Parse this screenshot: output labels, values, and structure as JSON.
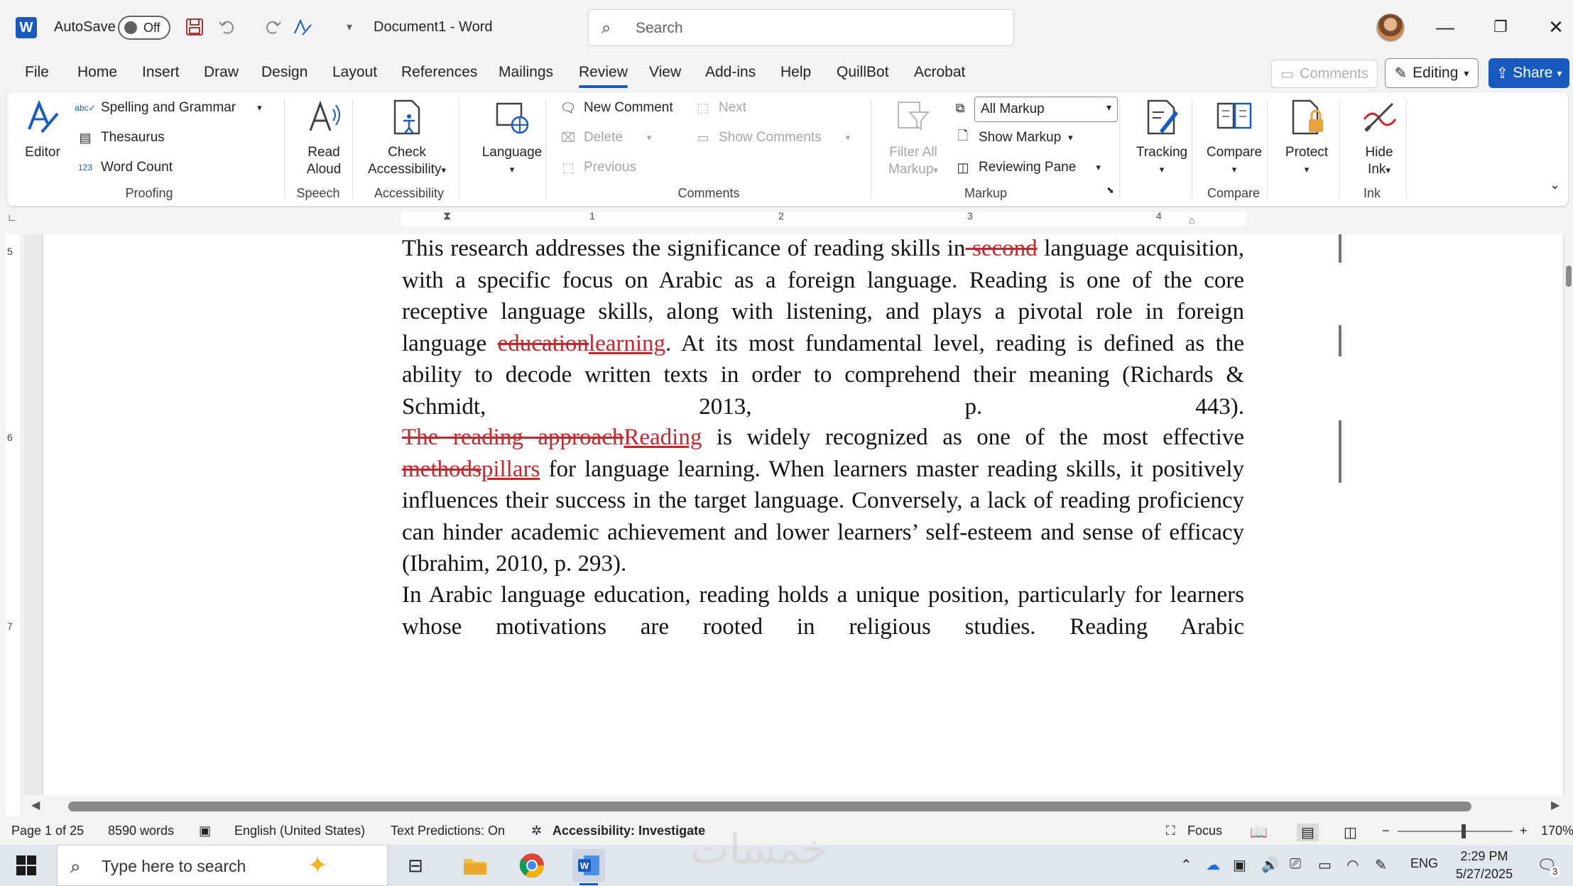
{
  "titlebar": {
    "app_logo": "W",
    "autosave_label": "AutoSave",
    "autosave_state": "Off",
    "document_title": "Document1  -  Word",
    "search_placeholder": "Search"
  },
  "menu": {
    "tabs": [
      "File",
      "Home",
      "Insert",
      "Draw",
      "Design",
      "Layout",
      "References",
      "Mailings",
      "Review",
      "View",
      "Add-ins",
      "Help",
      "QuillBot",
      "Acrobat"
    ],
    "active_tab": "Review",
    "comments_label": "Comments",
    "editing_label": "Editing",
    "share_label": "Share"
  },
  "ribbon": {
    "proofing": {
      "label": "Proofing",
      "editor": "Editor",
      "spelling": "Spelling and Grammar",
      "thesaurus": "Thesaurus",
      "word_count": "Word Count"
    },
    "speech": {
      "label": "Speech",
      "read_aloud_1": "Read",
      "read_aloud_2": "Aloud"
    },
    "accessibility": {
      "label": "Accessibility",
      "check_1": "Check",
      "check_2": "Accessibility"
    },
    "language": {
      "label": "Language"
    },
    "comments": {
      "label": "Comments",
      "new_comment": "New Comment",
      "delete": "Delete",
      "previous": "Previous",
      "next": "Next",
      "show_comments": "Show Comments"
    },
    "markup": {
      "label": "Markup",
      "filter_1": "Filter All",
      "filter_2": "Markup",
      "all_markup": "All Markup",
      "show_markup": "Show Markup",
      "reviewing_pane": "Reviewing Pane"
    },
    "tracking": {
      "label": "Tracking"
    },
    "compare": {
      "label": "Compare",
      "button": "Compare"
    },
    "protect": {
      "label": "Protect"
    },
    "ink": {
      "label": "Ink",
      "hide_1": "Hide",
      "hide_2": "Ink"
    }
  },
  "ruler": {
    "numbers": [
      "1",
      "2",
      "3",
      "4"
    ],
    "vnumbers": [
      "5",
      "6",
      "7"
    ]
  },
  "document": {
    "p1": {
      "a": "This research addresses the significance of reading skills in",
      "del1": " second",
      "b": " language acquisition, with a specific focus on Arabic as a foreign language. Reading is one of the core receptive language skills, along with listening, and plays a pivotal role in foreign language ",
      "del2": "education",
      "ins2": "learning",
      "c": ". At its most fundamental level, reading is defined as the ability to decode written texts in order to comprehend their meaning (Richards & Schmidt, 2013, p. 443)."
    },
    "p2": {
      "del1": "The reading approach",
      "ins1": "Reading",
      "a": " is widely recognized as one of the most effective ",
      "del2": "methods",
      "ins2": "pillars",
      "b": " for language learning. When learners master reading skills, it positively influences their success in the target language. Conversely, a lack of reading proficiency can hinder academic achievement and lower learners’ self-esteem and sense of efficacy (Ibrahim, 2010, p. 293)."
    },
    "p3": "In Arabic language education, reading holds a unique position, particularly for learners whose motivations are rooted in religious studies. Reading Arabic"
  },
  "status": {
    "page": "Page 1 of 25",
    "words": "8590 words",
    "language": "English (United States)",
    "predictions": "Text Predictions: On",
    "accessibility": "Accessibility: Investigate",
    "focus": "Focus",
    "zoom": "170%",
    "zoom_minus": "−",
    "zoom_plus": "+"
  },
  "taskbar": {
    "search_placeholder": "Type here to search",
    "language": "ENG",
    "time": "2:29 PM",
    "date": "5/27/2025",
    "notifications": "3"
  },
  "watermark": "خمسات",
  "colors": {
    "accent": "#185abd",
    "revision": "#c0282d"
  }
}
